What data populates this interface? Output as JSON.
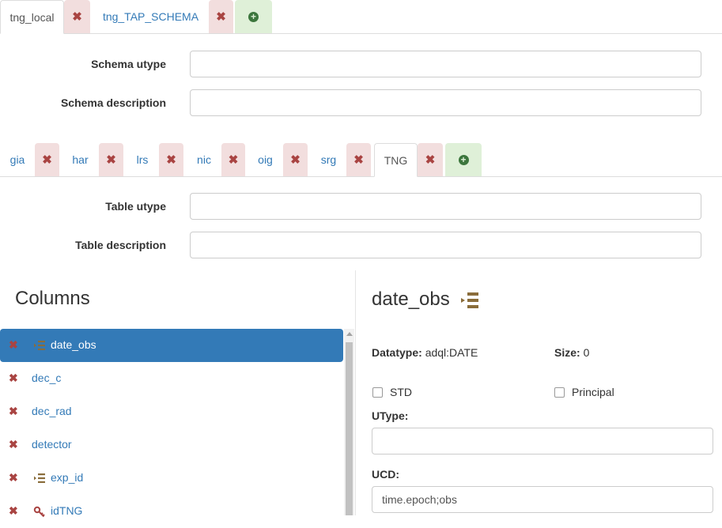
{
  "schema_tabs": {
    "items": [
      {
        "label": "tng_local",
        "active": true
      },
      {
        "label": "tng_TAP_SCHEMA",
        "active": false
      }
    ],
    "close_glyph": "✖",
    "add_glyph": "+"
  },
  "schema_form": {
    "utype_label": "Schema utype",
    "utype_value": "",
    "description_label": "Schema description",
    "description_value": ""
  },
  "table_tabs": {
    "items": [
      {
        "label": "gia",
        "active": false
      },
      {
        "label": "har",
        "active": false
      },
      {
        "label": "lrs",
        "active": false
      },
      {
        "label": "nic",
        "active": false
      },
      {
        "label": "oig",
        "active": false
      },
      {
        "label": "srg",
        "active": false
      },
      {
        "label": "TNG",
        "active": true
      }
    ]
  },
  "table_form": {
    "utype_label": "Table utype",
    "utype_value": "",
    "description_label": "Table description",
    "description_value": ""
  },
  "columns": {
    "title": "Columns",
    "items": [
      {
        "name": "date_obs",
        "icon": "indexed-icon",
        "active": true
      },
      {
        "name": "dec_c",
        "icon": "",
        "active": false
      },
      {
        "name": "dec_rad",
        "icon": "",
        "active": false
      },
      {
        "name": "detector",
        "icon": "",
        "active": false
      },
      {
        "name": "exp_id",
        "icon": "indexed-icon",
        "active": false
      },
      {
        "name": "idTNG",
        "icon": "key-icon",
        "active": false
      }
    ]
  },
  "detail": {
    "title": "date_obs",
    "datatype_label": "Datatype:",
    "datatype_value": "adql:DATE",
    "size_label": "Size:",
    "size_value": "0",
    "std_label": "STD",
    "principal_label": "Principal",
    "utype_label": "UType:",
    "utype_value": "",
    "ucd_label": "UCD:",
    "ucd_value": "time.epoch;obs"
  },
  "colors": {
    "link": "#337ab7",
    "active_bg": "#337ab7",
    "danger_bg": "#f2dede",
    "danger_fg": "#a94442",
    "success_bg": "#dff0d8",
    "success_fg": "#3c763d",
    "index_icon": "#8a6d3b"
  }
}
